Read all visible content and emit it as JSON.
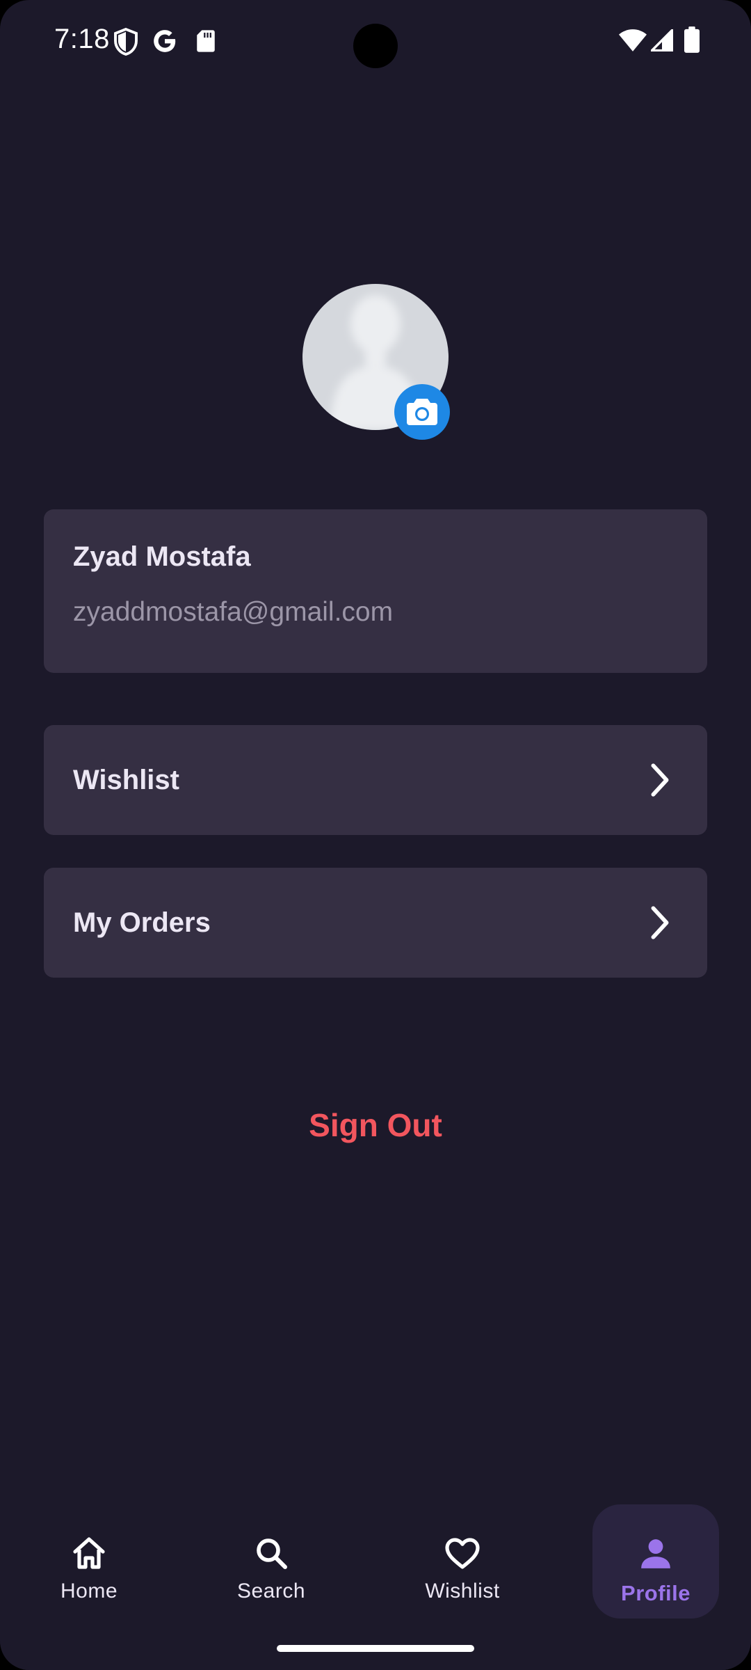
{
  "status_bar": {
    "time": "7:18",
    "left_icons": [
      "shield-icon",
      "google-icon",
      "sd-card-icon"
    ],
    "right_icons": [
      "wifi-icon",
      "signal-icon",
      "battery-icon"
    ]
  },
  "profile": {
    "avatar_icon": "person-silhouette-icon",
    "change_photo_icon": "camera-icon",
    "name": "Zyad Mostafa",
    "email": "zyaddmostafa@gmail.com"
  },
  "menu": {
    "items": [
      {
        "label": "Wishlist",
        "icon": "chevron-right-icon"
      },
      {
        "label": "My Orders",
        "icon": "chevron-right-icon"
      }
    ]
  },
  "sign_out": {
    "label": "Sign Out",
    "color": "#f2565e"
  },
  "bottom_nav": {
    "items": [
      {
        "label": "Home",
        "icon": "home-icon"
      },
      {
        "label": "Search",
        "icon": "search-icon"
      },
      {
        "label": "Wishlist",
        "icon": "heart-icon"
      },
      {
        "label": "Profile",
        "icon": "person-icon"
      }
    ],
    "active": "Profile",
    "active_color": "#9b74ea"
  },
  "colors": {
    "background": "#1c192a",
    "card": "#352f43",
    "accent_camera": "#1e88e5"
  }
}
